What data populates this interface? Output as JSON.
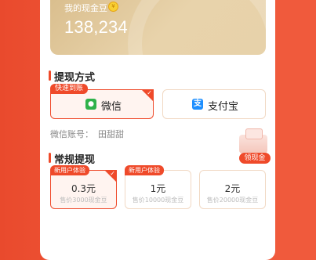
{
  "balance": {
    "label": "我的现金豆",
    "value": "138,234",
    "coin_icon": "coin-icon"
  },
  "withdraw_method": {
    "title": "提现方式",
    "fast_tag": "快速到账",
    "options": [
      {
        "label": "微信",
        "icon": "wechat-icon",
        "selected": true
      },
      {
        "label": "支付宝",
        "icon": "alipay-icon",
        "selected": false
      }
    ]
  },
  "account": {
    "label": "微信账号：",
    "name": "田甜甜"
  },
  "regular": {
    "title": "常规提现",
    "claim_button": "领现金",
    "amounts": [
      {
        "tag": "新用户体验",
        "value": "0.3元",
        "sub": "售价3000现金豆",
        "selected": true
      },
      {
        "tag": "新用户体验",
        "value": "1元",
        "sub": "售价10000现金豆",
        "selected": false
      },
      {
        "tag": "",
        "value": "2元",
        "sub": "售价20000现金豆",
        "selected": false
      }
    ]
  },
  "colors": {
    "accent": "#ef4a2a",
    "gold": "#d9bd8c",
    "wechat": "#2fb24a",
    "alipay": "#1e8fff"
  }
}
